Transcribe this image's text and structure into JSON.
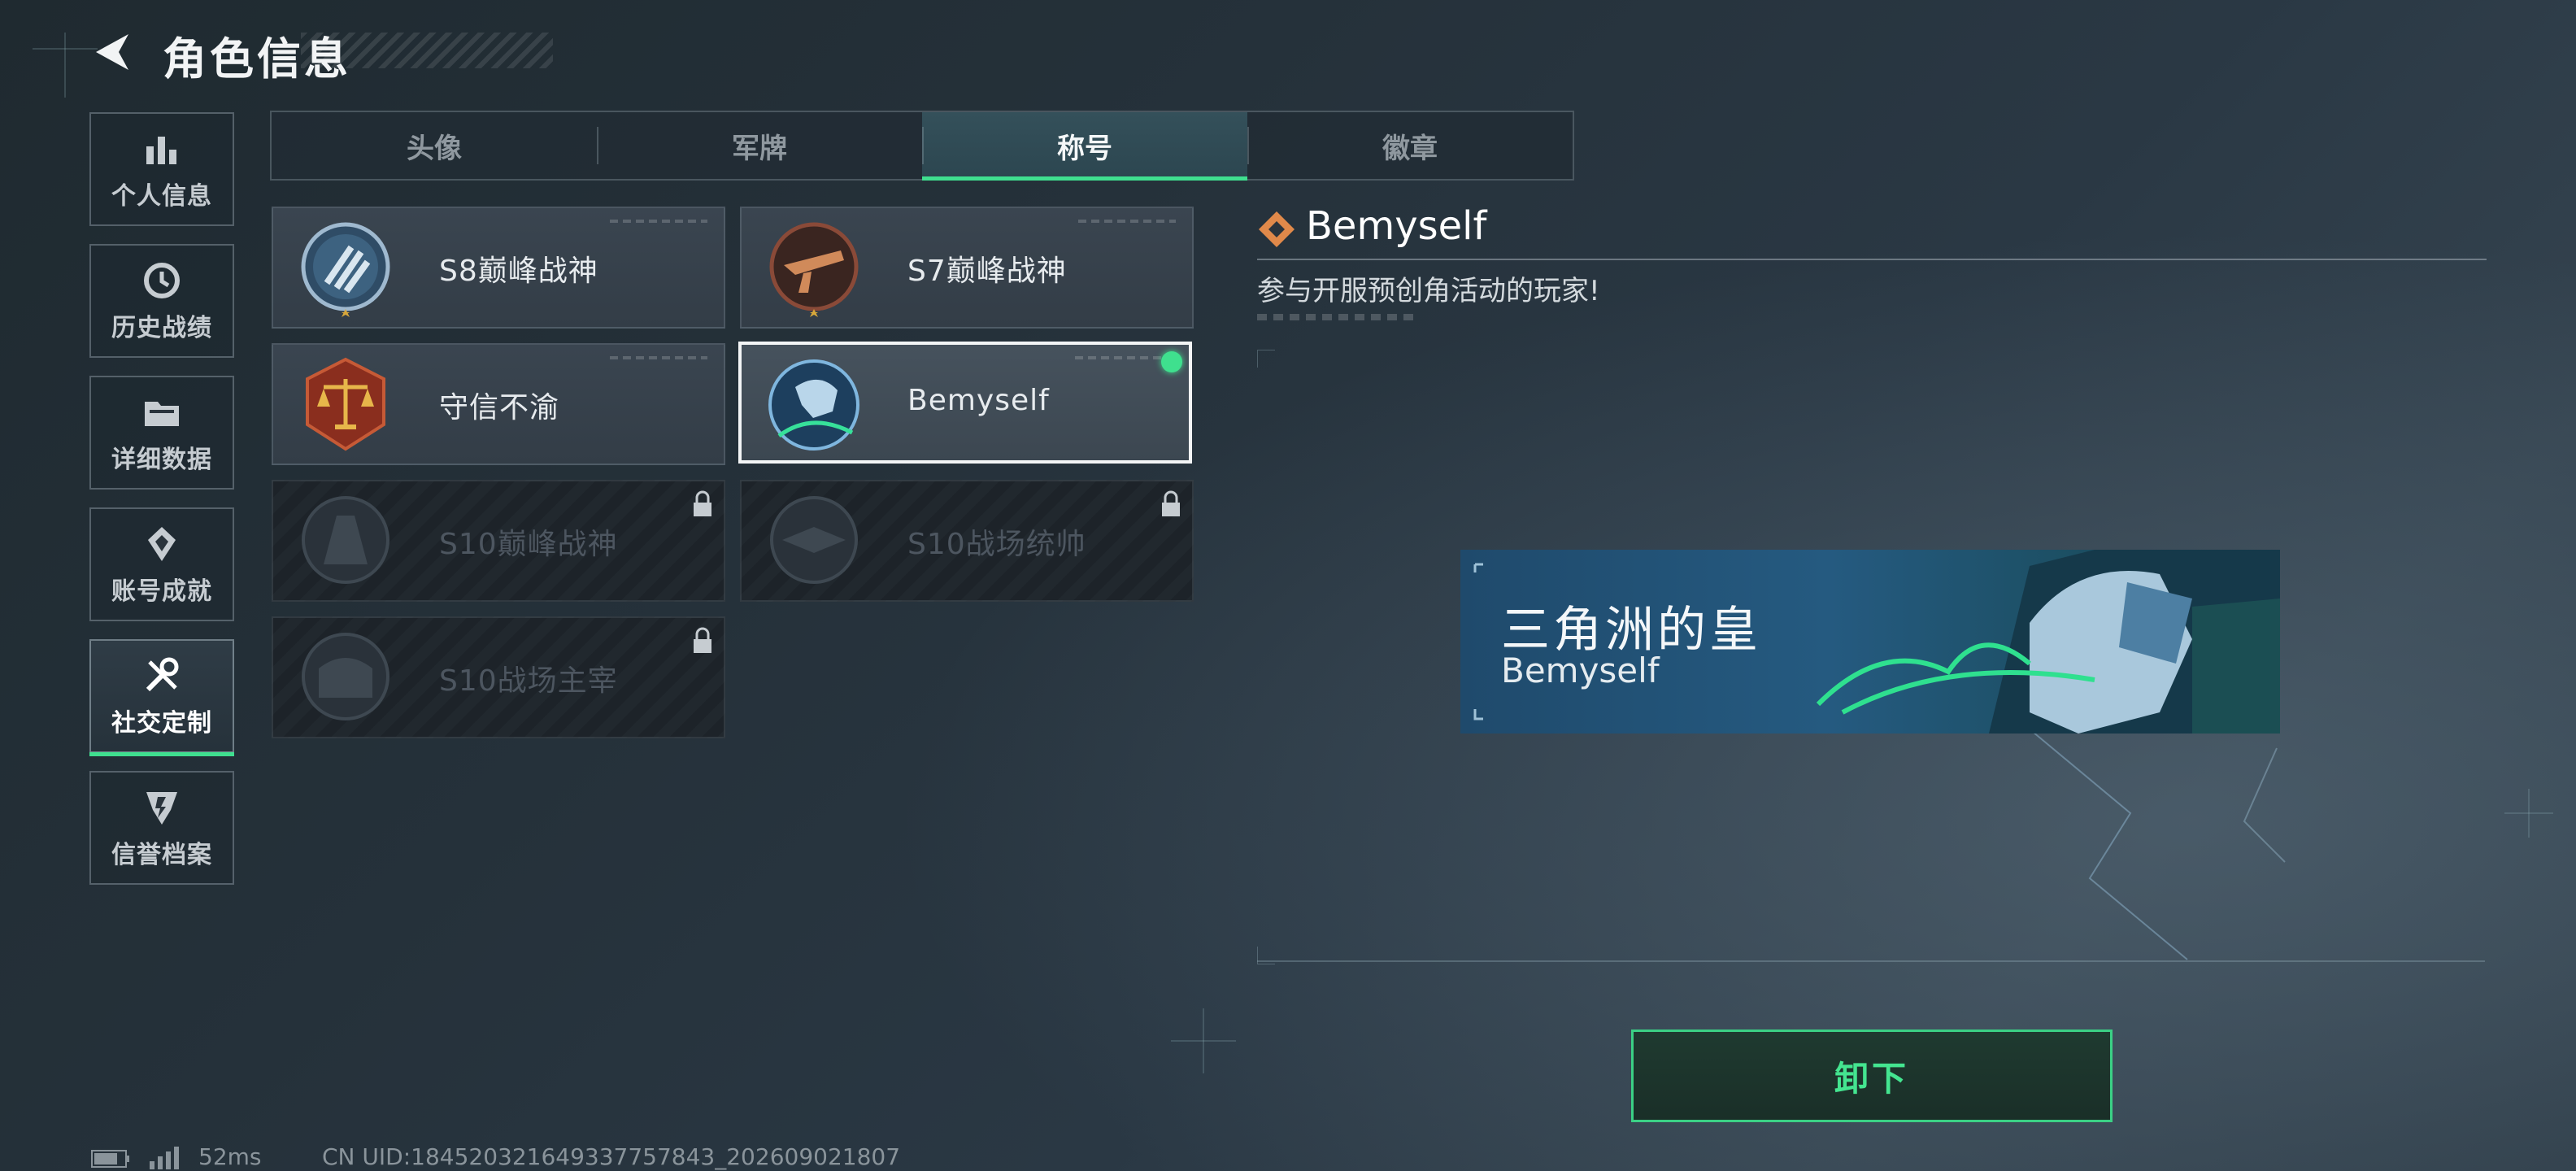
{
  "header": {
    "title": "角色信息"
  },
  "sidebar": {
    "items": [
      {
        "label": "个人信息",
        "icon": "bar-chart-icon"
      },
      {
        "label": "历史战绩",
        "icon": "history-clock-icon"
      },
      {
        "label": "详细数据",
        "icon": "folder-icon"
      },
      {
        "label": "账号成就",
        "icon": "achievement-icon"
      },
      {
        "label": "社交定制",
        "icon": "tools-icon",
        "active": true
      },
      {
        "label": "信誉档案",
        "icon": "credit-shield-icon"
      }
    ]
  },
  "tabs": [
    {
      "label": "头像"
    },
    {
      "label": "军牌"
    },
    {
      "label": "称号",
      "active": true
    },
    {
      "label": "徽章"
    }
  ],
  "titles": [
    {
      "name": "S8巅峰战神",
      "state": "unlocked"
    },
    {
      "name": "S7巅峰战神",
      "state": "unlocked"
    },
    {
      "name": "守信不渝",
      "state": "unlocked"
    },
    {
      "name": "Bemyself",
      "state": "equipped"
    },
    {
      "name": "S10巅峰战神",
      "state": "locked"
    },
    {
      "name": "S10战场统帅",
      "state": "locked"
    },
    {
      "name": "S10战场主宰",
      "state": "locked"
    }
  ],
  "detail": {
    "name": "Bemyself",
    "description": "参与开服预创角活动的玩家!",
    "banner": {
      "title": "三角洲的皇",
      "subtitle": "Bemyself"
    }
  },
  "actions": {
    "unequip": "卸下"
  },
  "status": {
    "ping": "52ms",
    "uid": "CN UID:184520321649337757843_202609021807"
  },
  "colors": {
    "accent": "#3fdf8f",
    "selected_border": "#f3f5f6",
    "bronze": "#d08a5a"
  }
}
